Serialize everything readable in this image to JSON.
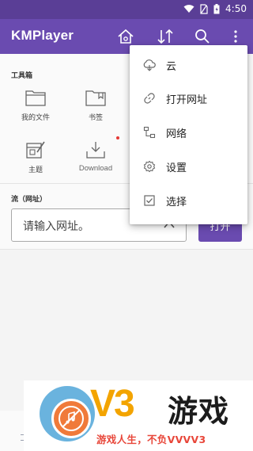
{
  "status_bar": {
    "time": "4:50"
  },
  "app_bar": {
    "title": "KMPlayer"
  },
  "toolbox": {
    "section_label": "工具箱",
    "tools": [
      {
        "label": "我的文件",
        "icon": "folder-icon"
      },
      {
        "label": "书签",
        "icon": "bookmark-folder-icon"
      },
      {
        "label": "主题",
        "icon": "theme-icon"
      },
      {
        "label": "Download",
        "icon": "download-icon"
      }
    ]
  },
  "stream": {
    "section_label": "流（网址）",
    "input_placeholder": "请输入网址。",
    "open_button": "打开"
  },
  "overflow_menu": {
    "items": [
      {
        "label": "云",
        "icon": "cloud-icon"
      },
      {
        "label": "打开网址",
        "icon": "link-icon"
      },
      {
        "label": "网络",
        "icon": "network-icon"
      },
      {
        "label": "设置",
        "icon": "gear-icon"
      },
      {
        "label": "选择",
        "icon": "checkbox-icon"
      }
    ]
  },
  "banner": {
    "brand_mark": "V3",
    "brand_name": "游戏",
    "slogan": "游戏人生，不负VVVV3"
  },
  "colors": {
    "primary": "#6a4bb0",
    "status_bar": "#5a3e96",
    "accent_orange": "#f3a400",
    "slogan_red": "#e8473a"
  }
}
